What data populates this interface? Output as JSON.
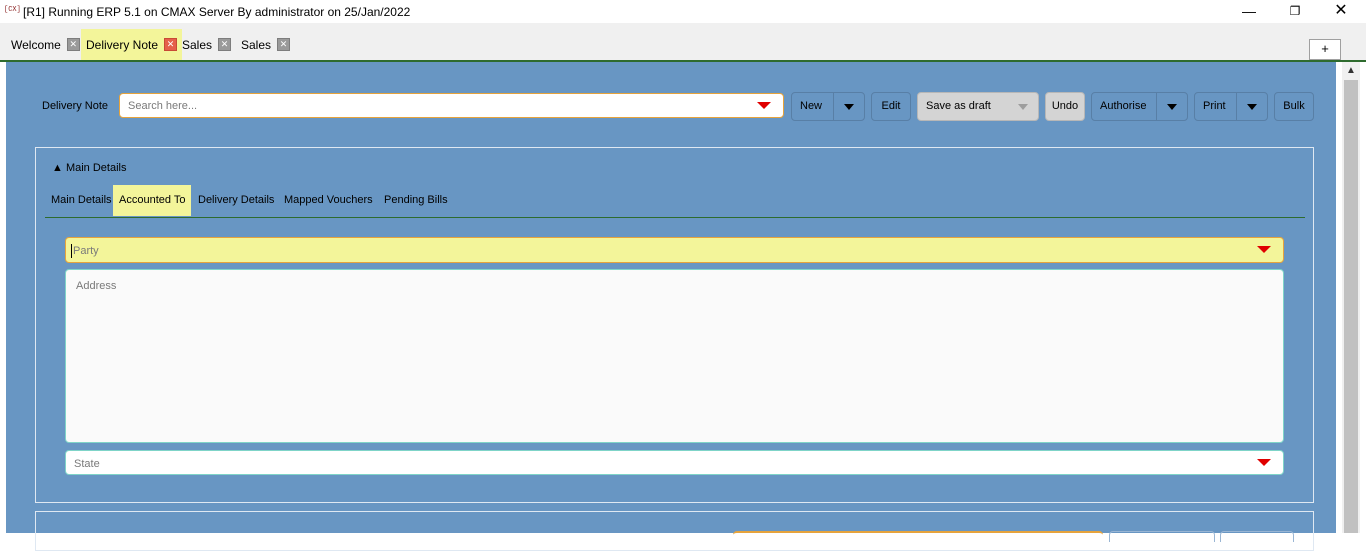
{
  "window": {
    "icon_text": "[CX]",
    "title": "[R1] Running ERP 5.1 on CMAX Server By administrator on 25/Jan/2022",
    "minimize_glyph": "—",
    "maximize_glyph": "❐",
    "close_glyph": "✕"
  },
  "tabs": [
    {
      "label": "Welcome",
      "active": false
    },
    {
      "label": "Delivery Note",
      "active": true
    },
    {
      "label": "Sales",
      "active": false
    },
    {
      "label": "Sales",
      "active": false
    }
  ],
  "tab_close_glyph": "✕",
  "add_tab_label": "+",
  "toolbar": {
    "label": "Delivery Note",
    "search_placeholder": "Search here...",
    "buttons": {
      "new": "New",
      "edit": "Edit",
      "save_as_draft": "Save as draft",
      "undo": "Undo",
      "authorise": "Authorise",
      "print": "Print",
      "bulk": "Bulk"
    }
  },
  "details": {
    "toggle_label": "▲ Main Details",
    "tabs": [
      "Main Details",
      "Accounted To",
      "Delivery Details",
      "Mapped Vouchers",
      "Pending Bills"
    ],
    "active_tab": "Accounted To",
    "fields": {
      "party_placeholder": "Party",
      "address_placeholder": "Address",
      "state_placeholder": "State"
    }
  },
  "scroll_up_glyph": "▲",
  "colors": {
    "panel_background": "#6896c3",
    "highlight_yellow": "#f3f59a",
    "dropdown_caret_red": "#e00000",
    "focus_border_orange": "#e6a33c",
    "tab_underline_green": "#2e6b2e"
  }
}
